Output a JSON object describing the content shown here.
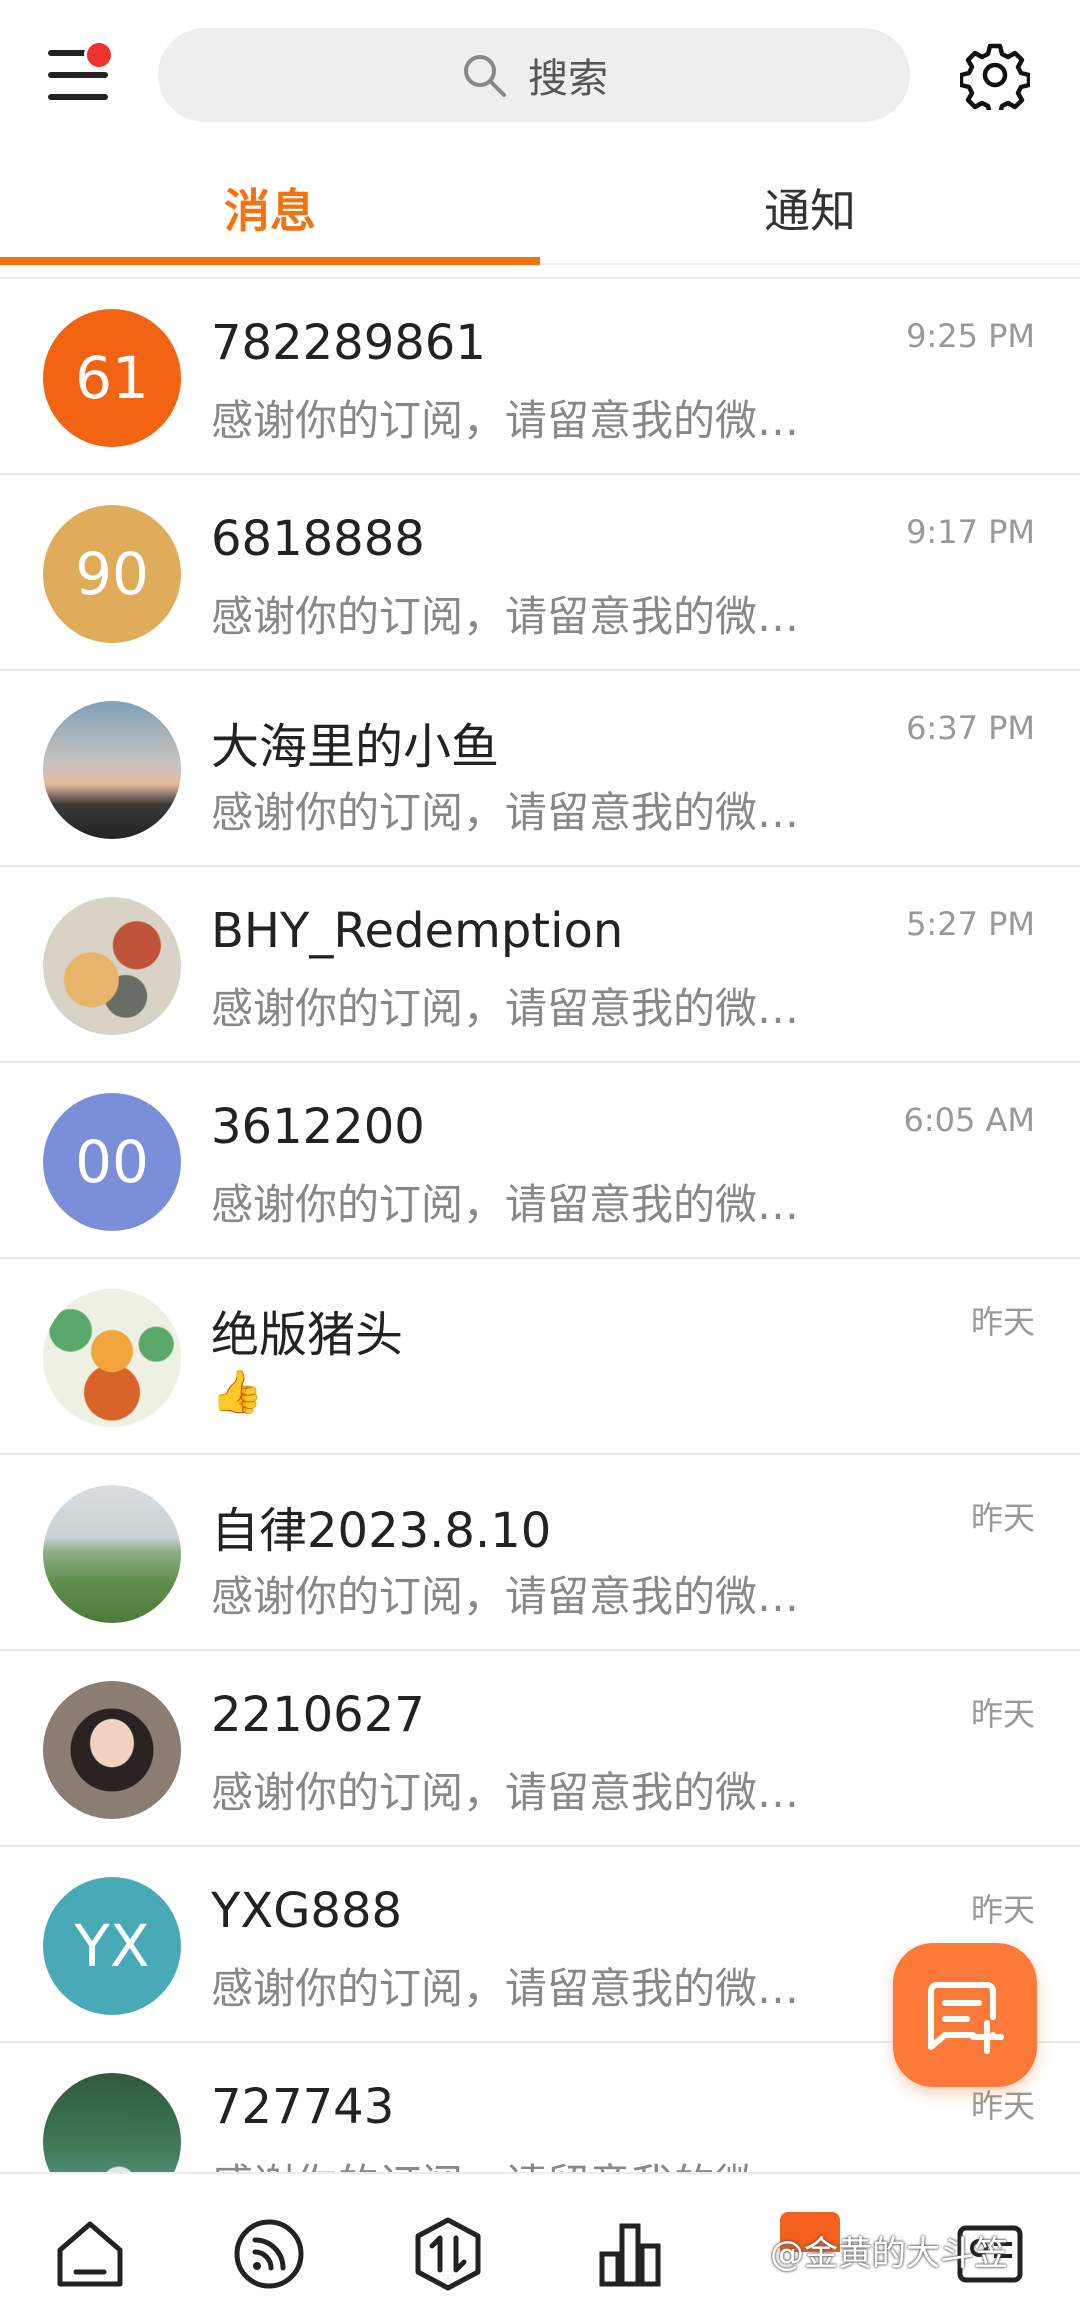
{
  "header": {
    "search_placeholder": "搜索",
    "icons": {
      "menu": "menu-icon",
      "search": "search-icon",
      "settings": "gear-icon"
    }
  },
  "tabs": [
    {
      "label": "消息",
      "active": true
    },
    {
      "label": "通知",
      "active": false
    }
  ],
  "conversations": [
    {
      "name": "782289861",
      "preview": "感谢你的订阅，请留意我的微…",
      "time": "9:25 PM",
      "avatar_text": "61",
      "avatar_color": "#f26412"
    },
    {
      "name": "6818888",
      "preview": "感谢你的订阅，请留意我的微…",
      "time": "9:17 PM",
      "avatar_text": "90",
      "avatar_color": "#e0ac5a"
    },
    {
      "name": "大海里的小鱼",
      "preview": "感谢你的订阅，请留意我的微…",
      "time": "6:37 PM",
      "avatar_text": "",
      "avatar_color": "#8a9aa8"
    },
    {
      "name": "BHY_Redemption",
      "preview": "感谢你的订阅，请留意我的微…",
      "time": "5:27 PM",
      "avatar_text": "",
      "avatar_color": "#b07050"
    },
    {
      "name": "3612200",
      "preview": "感谢你的订阅，请留意我的微…",
      "time": "6:05 AM",
      "avatar_text": "00",
      "avatar_color": "#7b8fd8"
    },
    {
      "name": "绝版猪头",
      "preview": "👍",
      "time": "昨天",
      "avatar_text": "",
      "avatar_color": "#e7e0c8"
    },
    {
      "name": "自律2023.8.10",
      "preview": "感谢你的订阅，请留意我的微…",
      "time": "昨天",
      "avatar_text": "",
      "avatar_color": "#7aa36a"
    },
    {
      "name": "2210627",
      "preview": "感谢你的订阅，请留意我的微…",
      "time": "昨天",
      "avatar_text": "",
      "avatar_color": "#6a5a52"
    },
    {
      "name": "YXG888",
      "preview": "感谢你的订阅，请留意我的微…",
      "time": "昨天",
      "avatar_text": "YX",
      "avatar_color": "#49aab7"
    },
    {
      "name": "727743",
      "preview": "感谢你的订阅，请留意我的微…",
      "time": "昨天",
      "avatar_text": "",
      "avatar_color": "#3f6a52"
    }
  ],
  "fab": {
    "icon": "new-message-icon"
  },
  "bottom_nav": {
    "items": [
      "home-icon",
      "feed-icon",
      "trade-icon",
      "chart-icon",
      "messages-icon",
      "profile-card-icon"
    ],
    "watermark": "@金黄的大斗笠"
  },
  "colors": {
    "accent": "#f4730e",
    "fab": "#fb7a3a",
    "badge": "#f0312f"
  }
}
